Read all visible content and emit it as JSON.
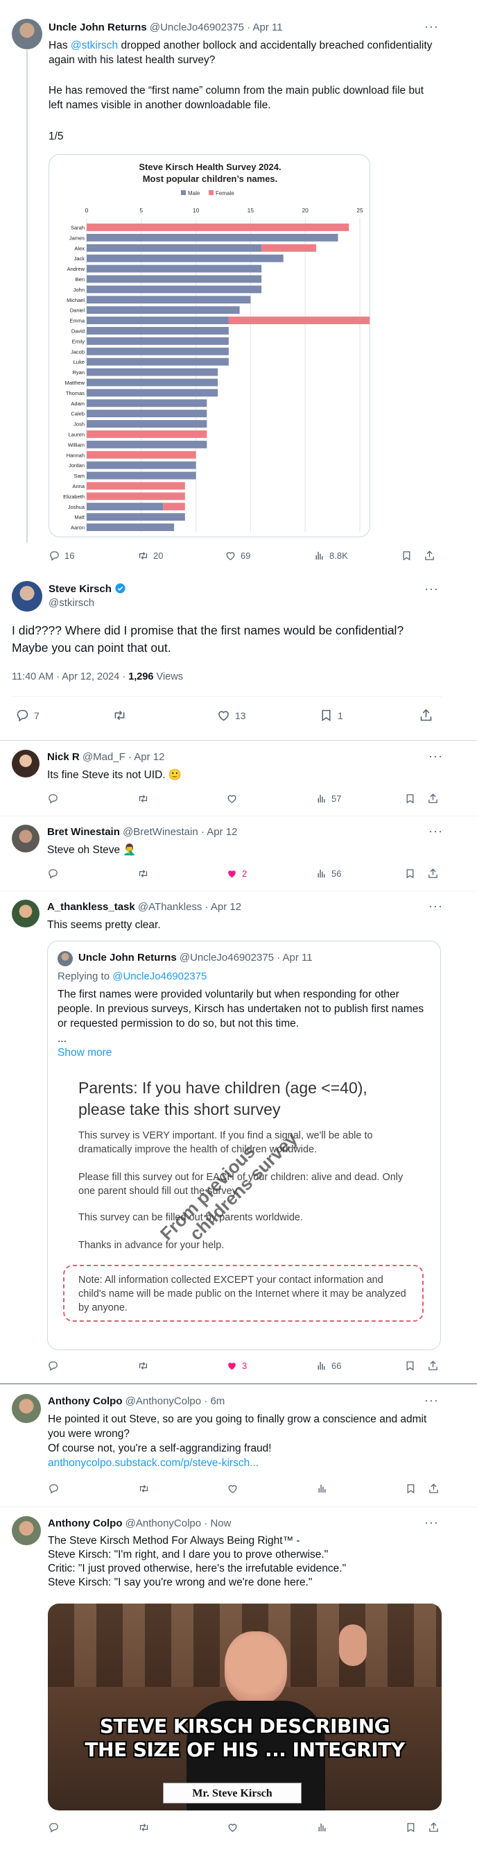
{
  "tweet1": {
    "name": "Uncle John Returns",
    "handle": "@UncleJo46902375",
    "time": "Apr 11",
    "mention": "@stkirsch",
    "text1_rest": " dropped another bollock and accidentally breached confidentiality again with his latest health survey?",
    "text2": "He has removed the “first name” column from the main public download file but left names visible in another downloadable file.",
    "text3": "1/5",
    "replies": "16",
    "retweets": "20",
    "likes": "69",
    "views": "8.8K"
  },
  "chart_data": {
    "type": "bar",
    "orientation": "horizontal",
    "title": "Steve Kirsch Health Survey 2024.",
    "subtitle": "Most popular  children’s names.",
    "legend": [
      "Male",
      "Female"
    ],
    "legend_placement": "top",
    "xlim": [
      0,
      25
    ],
    "xticks": [
      "0",
      "5",
      "10",
      "15",
      "20",
      "25"
    ],
    "grid": true,
    "colors": {
      "Male": "#7a89ad",
      "Female": "#ef7d85"
    },
    "categories": [
      "Sarah",
      "James",
      "Alex",
      "Jack",
      "Andrew",
      "Ben",
      "John",
      "Michael",
      "Daniel",
      "Emma",
      "David",
      "Emily",
      "Jacob",
      "Luke",
      "Ryan",
      "Matthew",
      "Thomas",
      "Adam",
      "Caleb",
      "Josh",
      "Lauren",
      "William",
      "Hannah",
      "Jordan",
      "Sam",
      "Anna",
      "Elizabeth",
      "Joshua",
      "Matt",
      "Aaron"
    ],
    "series": [
      {
        "name": "Male",
        "values": [
          0,
          23,
          16,
          18,
          16,
          16,
          16,
          15,
          14,
          13,
          13,
          13,
          13,
          13,
          12,
          12,
          12,
          11,
          11,
          11,
          0,
          11,
          0,
          10,
          10,
          0,
          0,
          7,
          9,
          8
        ]
      },
      {
        "name": "Female",
        "values": [
          24,
          0,
          5,
          0,
          0,
          0,
          0,
          0,
          0,
          14,
          0,
          0,
          0,
          0,
          0,
          0,
          0,
          0,
          0,
          0,
          11,
          0,
          10,
          0,
          0,
          9,
          9,
          2,
          0,
          0
        ]
      }
    ]
  },
  "tweet2": {
    "name": "Steve Kirsch",
    "handle": "@stkirsch",
    "text": "I did???? Where did I promise that the first names would be confidential? Maybe you can point that out.",
    "time": "11:40 AM · Apr 12, 2024 · ",
    "views_count": "1,296",
    "views_label": " Views",
    "replies": "7",
    "likes": "13",
    "bookmarks": "1"
  },
  "reply1": {
    "name": "Nick R",
    "handle": "@Mad_F",
    "time": "Apr 12",
    "text": "Its fine Steve its not UID. 🙂",
    "views": "57"
  },
  "reply2": {
    "name": "Bret Winestain",
    "handle": "@BretWinestain",
    "time": "Apr 12",
    "text": "Steve oh Steve 🤦‍♂️",
    "likes": "2",
    "views": "56"
  },
  "reply3": {
    "name": "A_thankless_task",
    "handle": "@AThankless",
    "time": "Apr 12",
    "text": "This seems pretty clear.",
    "likes": "3",
    "views": "66",
    "quote": {
      "name": "Uncle John Returns",
      "handle": "@UncleJo46902375",
      "time": "Apr 11",
      "replying": "Replying to ",
      "replying_handle": "@UncleJo46902375",
      "text": "The first names were provided voluntarily but when responding for other people. In previous surveys, Kirsch has undertaken not to publish first names or requested permission to do so, but not this time.",
      "ellipsis": "...",
      "show_more": "Show more",
      "survey_title": "Parents: If you have children (age <=40), please take this short survey",
      "survey_p1": "This survey is VERY important. If you find a signal, we'll be able to dramatically improve the health of children worldwide.",
      "survey_p2": "Please fill this survey out for EACH of your children: alive and dead. Only one parent should fill out the survey.",
      "survey_p3": "This survey can be filled out by parents worldwide.",
      "survey_p4": "Thanks in advance for your help.",
      "survey_note": "Note: All information collected EXCEPT your contact information and child's name will be made public on the Internet where it may be analyzed by anyone.",
      "watermark1": "From previous",
      "watermark2": "childrens survey"
    }
  },
  "reply4": {
    "name": "Anthony Colpo",
    "handle": "@AnthonyColpo",
    "time": "6m",
    "text": "He pointed it out Steve, so are you going to finally grow a conscience and admit you were wrong?\nOf course not, you're a self-aggrandizing fraud!",
    "link": "anthonycolpo.substack.com/p/steve-kirsch..."
  },
  "reply5": {
    "name": "Anthony Colpo",
    "handle": "@AnthonyColpo",
    "time": "Now",
    "text": "The Steve Kirsch Method For Always Being Right™ -\nSteve Kirsch: \"I'm right, and I dare you to prove otherwise.\"\nCritic: \"I just proved otherwise, here's the irrefutable evidence.\"\nSteve Kirsch: \"I say you're wrong and we're done here.\"",
    "meme_line1": "STEVE KIRSCH DESCRIBING",
    "meme_line2": "THE SIZE OF HIS ... INTEGRITY",
    "nameplate": "Mr. Steve Kirsch"
  }
}
